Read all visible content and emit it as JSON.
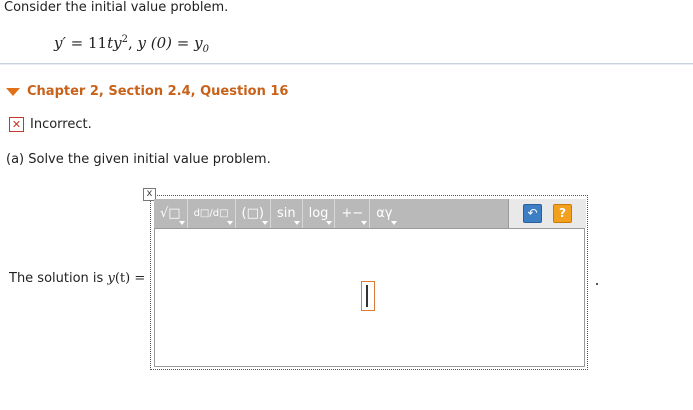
{
  "problem": {
    "intro": "Consider the initial value problem.",
    "equation": {
      "lhs": "y′",
      "rhs_coef": "11",
      "rhs_var": "ty",
      "rhs_exp": "2",
      "ic": "y (0) = y",
      "ic_sub": "0"
    }
  },
  "section": {
    "title": "Chapter 2, Section 2.4, Question 16",
    "status": "Incorrect."
  },
  "part_a": {
    "prompt": "(a) Solve the given initial value problem.",
    "solution_prefix": "The solution is ",
    "solution_func": "y",
    "solution_paren": "(t) ="
  },
  "editor": {
    "toolbar": {
      "radicals": "√□",
      "calculus": "d□/d□",
      "parens": "(□)",
      "trig": "sin",
      "log": "log",
      "ops": "+−",
      "greek": "αγ"
    },
    "undo_icon": "undo-icon",
    "help_icon": "help-icon",
    "help_label": "?",
    "close_label": "x"
  },
  "colors": {
    "accent": "#c8621a",
    "error": "#c0392b",
    "toolbar": "#b9b9b9"
  }
}
